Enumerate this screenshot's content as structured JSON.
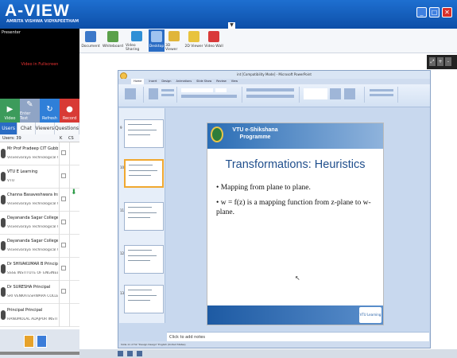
{
  "app": {
    "title": "A-VIEW",
    "subtitle": "AMRITA VISHWA VIDYAPEETHAM"
  },
  "window_buttons": [
    "minimize",
    "restore",
    "close"
  ],
  "presenter": {
    "label": "Presenter",
    "video_message": "Video in Fullscreen"
  },
  "controls": [
    {
      "label": "Video",
      "icon": "video-icon"
    },
    {
      "label": "Enter Text",
      "icon": "text-icon"
    },
    {
      "label": "Refresh",
      "icon": "refresh-icon"
    },
    {
      "label": "Record",
      "icon": "record-icon"
    }
  ],
  "tabs": [
    {
      "label": "Users",
      "active": true
    },
    {
      "label": "Chat",
      "active": false
    },
    {
      "label": "Viewers",
      "active": false
    },
    {
      "label": "Questions",
      "active": false
    }
  ],
  "users_header": {
    "count": "Users: 39",
    "col1": "K",
    "col2": "CS"
  },
  "users": [
    {
      "name": "Mr Prof Pradeep CIT Gubbi",
      "org": "Visvesvaraya Technological Univ"
    },
    {
      "name": "VTU E Learning",
      "org": "VTU"
    },
    {
      "name": "Channa Basaveshwara Instit",
      "org": "Visvesvaraya Technological Univ"
    },
    {
      "name": "Dayananda Sagar  College of",
      "org": "Visvesvaraya Technological Univ"
    },
    {
      "name": "Dayananda Sagar  College of",
      "org": "Visvesvaraya Technological Univ"
    },
    {
      "name": "Dr SHIVAKUMAR B Principal",
      "org": "SSSE INSTITUTE OF ENGINEER"
    },
    {
      "name": "Dr SURESHA Principal",
      "org": "SRI VENKATESHWARA COLLEG"
    },
    {
      "name": "Principal Principal",
      "org": "HANUMOLAL ADAJPUR INSTITU"
    }
  ],
  "toolbar": [
    {
      "label": "Document",
      "icon": "document-icon",
      "active": false
    },
    {
      "label": "Whiteboard",
      "icon": "whiteboard-icon",
      "active": false
    },
    {
      "label": "Video Sharing",
      "icon": "video-sharing-icon",
      "active": false
    },
    {
      "label": "Desktop",
      "icon": "desktop-icon",
      "active": true
    },
    {
      "label": "3D Viewer",
      "icon": "3d-viewer-icon",
      "active": false
    },
    {
      "label": "2D Viewer",
      "icon": "2d-viewer-icon",
      "active": false
    },
    {
      "label": "Video Wall",
      "icon": "video-wall-icon",
      "active": false
    }
  ],
  "powerpoint": {
    "title": "int [Compatibility Mode] - Microsoft PowerPoint",
    "ribbon_tabs": [
      "Home",
      "Insert",
      "Design",
      "Animations",
      "Slide Show",
      "Review",
      "View"
    ],
    "notes_placeholder": "Click to add notes",
    "status": "Slide 11 of 52   \"Design Design\"   English (United States)"
  },
  "slide": {
    "programme": "VTU e-Shikshana Programme",
    "title": "Transformations: Heuristics",
    "bullet1": "Mapping from plane to plane.",
    "bullet2": "w = f(z) is a mapping function from z-plane to w-plane.",
    "footer_logo": "VTU Learning"
  },
  "colors": {
    "brand_blue": "#1e6fd0",
    "active_tab": "#2a6cc4",
    "slide_title": "#1f4e8c"
  }
}
